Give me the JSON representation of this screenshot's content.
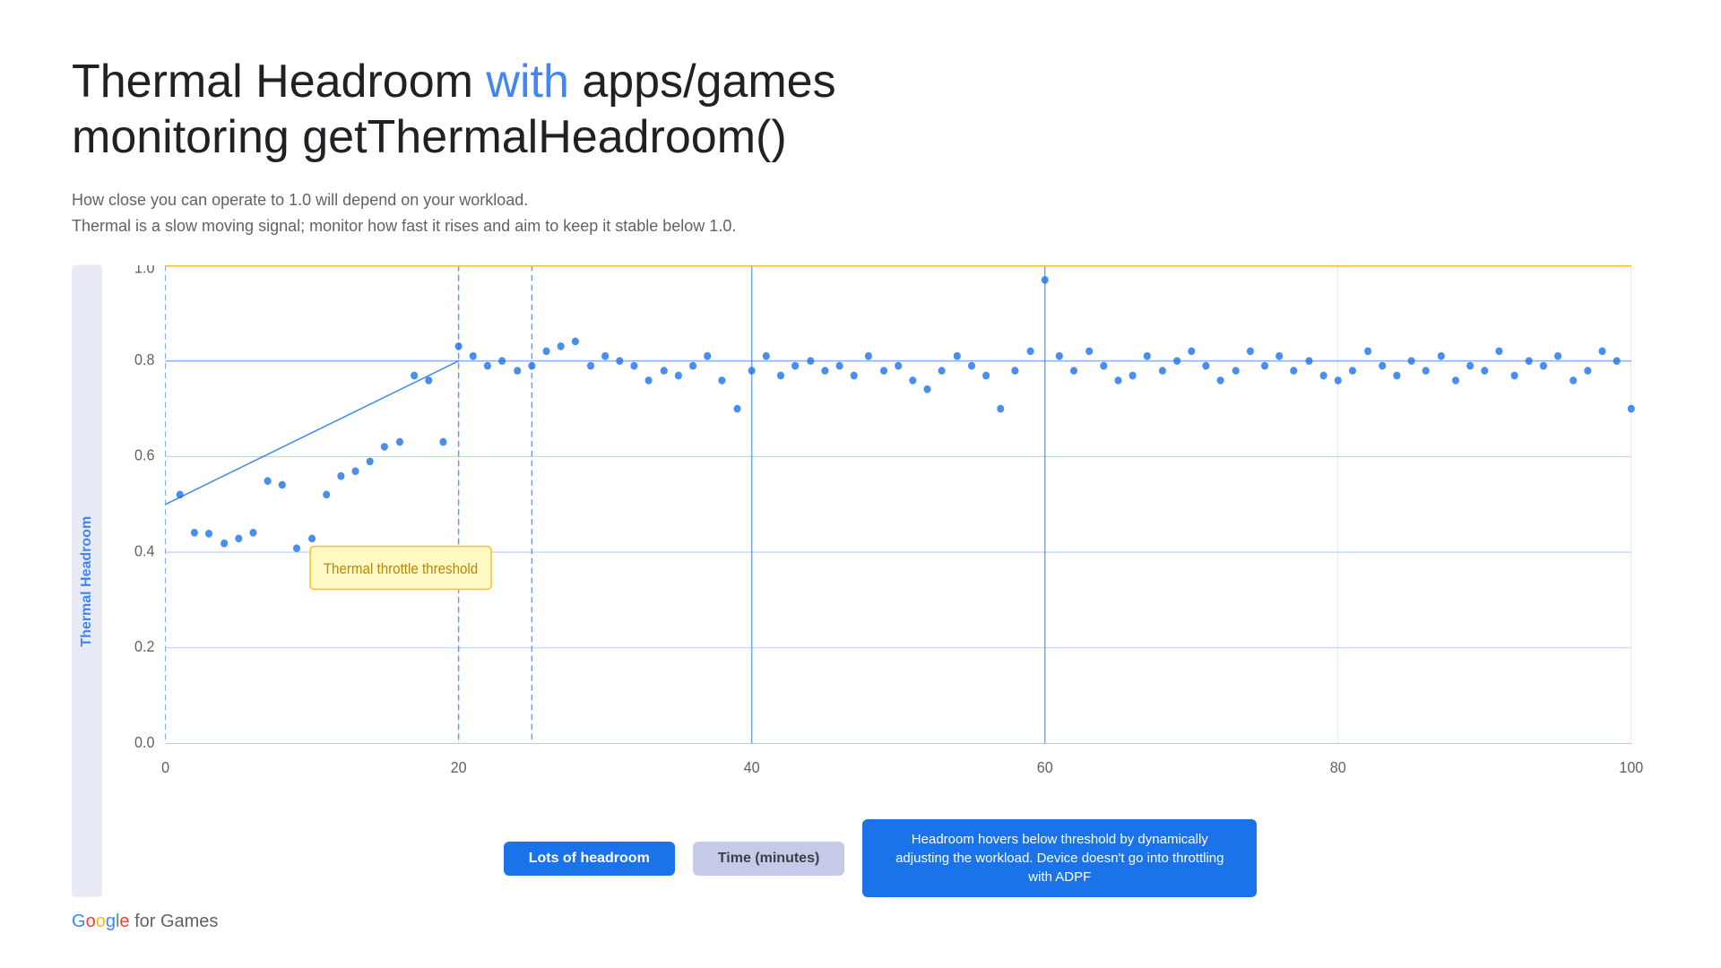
{
  "title": {
    "part1": "Thermal Headroom ",
    "highlight": "with",
    "part2": " apps/games",
    "line2": "monitoring getThermalHeadroom()"
  },
  "subtitle": {
    "line1": "How close you can operate to 1.0 will depend on your workload.",
    "line2": "Thermal is a slow moving signal; monitor how fast it rises and aim to keep it stable below 1.0."
  },
  "chart": {
    "y_axis_label": "Thermal Headroom",
    "x_axis_label": "Time (minutes)",
    "threshold_label": "Thermal throttle threshold",
    "y_ticks": [
      "0.0",
      "0.2",
      "0.4",
      "0.6",
      "0.8",
      "1.0"
    ],
    "x_ticks": [
      "0",
      "20",
      "40",
      "60",
      "80",
      "100"
    ],
    "threshold_value": 1.0,
    "colors": {
      "threshold_line": "#FBC02D",
      "data_points": "#1a73e8",
      "trend_line": "#1a73e8",
      "grid_line": "#4285F4",
      "dashed_vertical": "#4285F4",
      "solid_vertical": "#4285F4"
    }
  },
  "labels": {
    "lots_of_headroom": "Lots of headroom",
    "time_minutes": "Time (minutes)",
    "adpf_info": "Headroom hovers below threshold by dynamically adjusting the workload. Device doesn't go into throttling with ADPF"
  },
  "footer": {
    "google": "Google",
    "for_games": " for Games"
  }
}
